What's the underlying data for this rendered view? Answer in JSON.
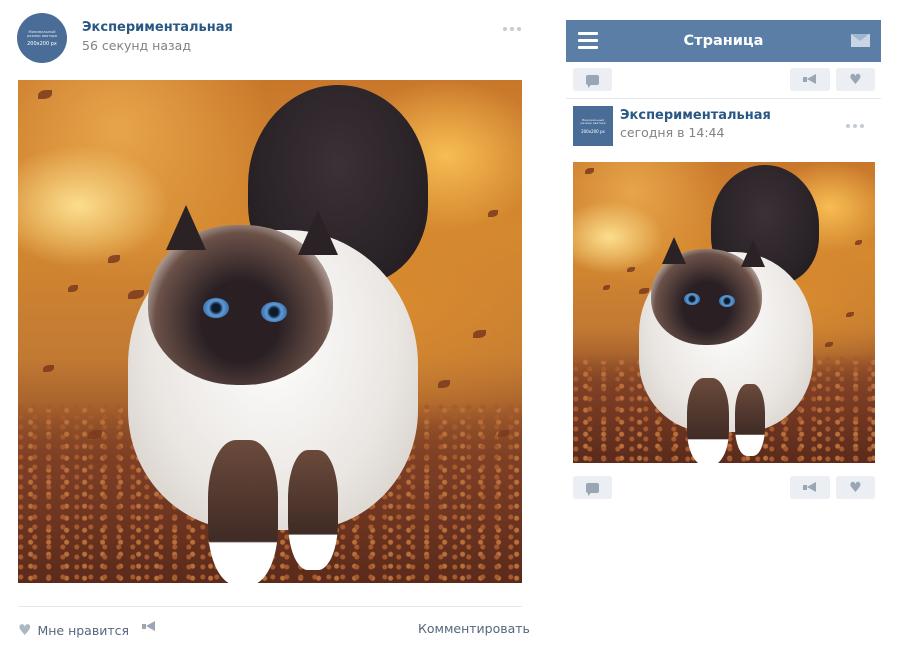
{
  "desktop_post": {
    "avatar_text": "Минимальный размер аватара",
    "avatar_size": "200x200 px",
    "author": "Экспериментальная",
    "time": "56 секунд назад",
    "actions": {
      "like_label": "Мне нравится",
      "comment_label": "Комментировать"
    }
  },
  "mobile": {
    "header_title": "Страница",
    "post": {
      "avatar_text": "Минимальный размер аватара",
      "avatar_size": "200x200 px",
      "author": "Экспериментальная",
      "time": "сегодня в 14:44"
    }
  },
  "icons": {
    "menu": "hamburger-icon",
    "mail": "mail-icon",
    "comment": "comment-bubble-icon",
    "share": "megaphone-icon",
    "like": "heart-icon",
    "more": "more-dots-icon"
  },
  "colors": {
    "header_bg": "#5b7ea6",
    "author_link": "#2a5885",
    "muted_text": "#828282",
    "button_bg": "#ebeef2"
  }
}
